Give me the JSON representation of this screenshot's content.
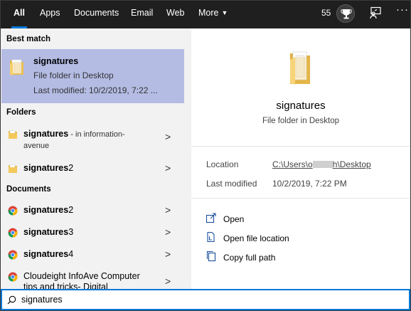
{
  "tabs": [
    {
      "label": "All",
      "active": true
    },
    {
      "label": "Apps"
    },
    {
      "label": "Documents"
    },
    {
      "label": "Email"
    },
    {
      "label": "Web"
    },
    {
      "label": "More"
    }
  ],
  "topbar": {
    "points": "55",
    "trophy_icon": "trophy-icon",
    "feedback_icon": "feedback-icon",
    "more_icon": "ellipsis-icon"
  },
  "sections": {
    "best_match": "Best match",
    "folders": "Folders",
    "documents": "Documents"
  },
  "best_match": {
    "name": "signatures",
    "type": "File folder in Desktop",
    "modified": "Last modified: 10/2/2019, 7:22 ...",
    "icon": "folder-icon"
  },
  "folders": [
    {
      "bold": "signatures",
      "suffix": " - in information-",
      "line2": "avenue",
      "icon": "folder-icon"
    },
    {
      "bold": "signatures",
      "plain": "2",
      "icon": "folder-icon"
    }
  ],
  "documents": [
    {
      "bold": "signatures",
      "plain": "2",
      "icon": "chrome-icon"
    },
    {
      "bold": "signatures",
      "plain": "3",
      "icon": "chrome-icon"
    },
    {
      "bold": "signatures",
      "plain": "4",
      "icon": "chrome-icon"
    },
    {
      "line1": "Cloudeight InfoAve Computer",
      "line2": "tips and tricks- Digital",
      "icon": "chrome-icon"
    }
  ],
  "preview": {
    "title": "signatures",
    "subtitle": "File folder in Desktop",
    "location_label": "Location",
    "location_pre": "C:\\Users\\o",
    "location_post": "h\\Desktop",
    "modified_label": "Last modified",
    "modified_value": "10/2/2019, 7:22 PM",
    "actions": [
      {
        "label": "Open",
        "icon": "open-icon"
      },
      {
        "label": "Open file location",
        "icon": "file-location-icon"
      },
      {
        "label": "Copy full path",
        "icon": "copy-icon"
      }
    ]
  },
  "search": {
    "value": "signatures",
    "icon": "search-icon"
  },
  "colors": {
    "accent": "#0078d7",
    "selection": "#b4bce4",
    "topbar": "#1f1f1f"
  }
}
